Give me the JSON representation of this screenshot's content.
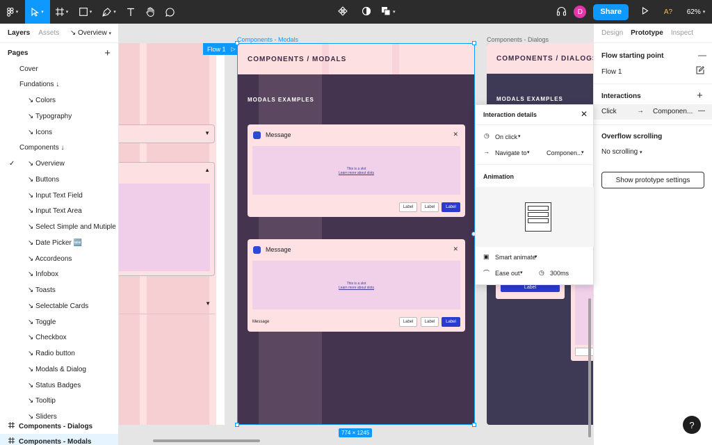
{
  "toolbar": {
    "share_label": "Share",
    "avatar_initial": "D",
    "a11y_label": "A?",
    "zoom_label": "62%"
  },
  "left_panel": {
    "tabs": [
      "Layers",
      "Assets"
    ],
    "page_select": "Overview",
    "pages_header": "Pages",
    "pages": [
      "Cover",
      "Fundations ↓",
      "↘ Colors",
      "↘ Typography",
      "↘ Icons",
      "Components ↓",
      "↘ Overview",
      "↘ Buttons",
      "↘ Input Text Field",
      "↘ Input Text Area",
      "↘ Select Simple and  Mutiple",
      "↘ Date Picker 🆕",
      "↘ Accordeons",
      "↘ Infobox",
      "↘ Toasts",
      "↘ Selectable Cards",
      "↘ Toggle",
      "↘ Checkbox",
      "↘ Radio button",
      "↘ Modals & Dialog",
      "↘ Status Badges",
      "↘ Tooltip",
      "↘ Sliders"
    ],
    "bottom_layers": [
      "Components - Dialogs",
      "Components - Modals"
    ]
  },
  "canvas": {
    "frame_modals_label": "Components - Modals",
    "frame_dialogs_label": "Components - Dialogs",
    "flow_badge": "Flow 1",
    "modals_title": "COMPONENTS / MODALS",
    "modals_subtitle": "MODALS EXAMPLES",
    "dialogs_title": "COMPONENTS / DIALOGS",
    "dialogs_subtitle": "MODALS EXAMPLES",
    "card_title": "Message",
    "slot_text": "This is a slot",
    "slot_link": "Learn more about slots",
    "btn_label": "Label",
    "footer_message": "Message",
    "dimensions": "774 × 1245"
  },
  "popover": {
    "title": "Interaction details",
    "trigger": "On click",
    "action": "Navigate to",
    "destination": "Componen...",
    "animation_title": "Animation",
    "animation_type": "Smart animate",
    "easing": "Ease out",
    "duration": "300ms"
  },
  "right_panel": {
    "tabs": [
      "Design",
      "Prototype",
      "Inspect"
    ],
    "flow_start_title": "Flow starting point",
    "flow_name": "Flow 1",
    "interactions_title": "Interactions",
    "interaction_trigger": "Click",
    "interaction_target": "Componen...",
    "overflow_title": "Overflow scrolling",
    "overflow_value": "No scrolling",
    "settings_button": "Show prototype settings"
  },
  "colors": {
    "accent": "#0d99ff",
    "toolbar_bg": "#2c2c2c",
    "modal_bg": "#45344f",
    "frame_pink": "#fde0e1"
  }
}
